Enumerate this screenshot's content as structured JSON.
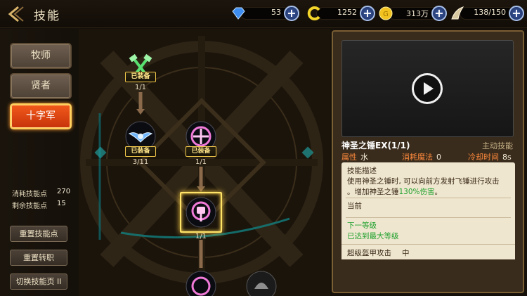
{
  "header": {
    "title": "技能",
    "resources": {
      "gems": "53",
      "currency2": "1252",
      "gold": "313万",
      "stamina": "138/150"
    }
  },
  "classes": [
    {
      "label": "牧师"
    },
    {
      "label": "贤者"
    },
    {
      "label": "十字军"
    }
  ],
  "skill_points": {
    "used_label": "消耗技能点",
    "used_value": "270",
    "remaining_label": "剩余技能点",
    "remaining_value": "15"
  },
  "buttons": {
    "reset_points": "重置技能点",
    "reset_job": "重置转职",
    "switch_page": "切换技能页 II"
  },
  "tree": {
    "equipped_label": "已装备",
    "nodes": [
      {
        "level": "1/1",
        "equipped": true
      },
      {
        "level": "3/11",
        "equipped": true
      },
      {
        "level": "1/1",
        "equipped": true
      },
      {
        "level": "1/1",
        "equipped": false
      }
    ]
  },
  "detail": {
    "name": "神圣之锤EX(1/1)",
    "type": "主动技能",
    "attr_label": "属性",
    "attr_value": "水",
    "mana_label": "消耗魔法",
    "mana_value": "0",
    "cd_label": "冷却时间",
    "cd_value": "8s",
    "desc_title": "技能描述",
    "desc_line1": "使用神圣之锤时, 可以向前方发射飞锤进行攻击",
    "desc_line2_a": "。增加神圣之锤",
    "desc_line2_b": "130%伤害",
    "desc_line2_c": "。",
    "current_label": "当前",
    "next_label": "下一等级",
    "max_label": "已达到最大等级",
    "armor_label": "超级盔甲攻击",
    "armor_value": "中"
  }
}
